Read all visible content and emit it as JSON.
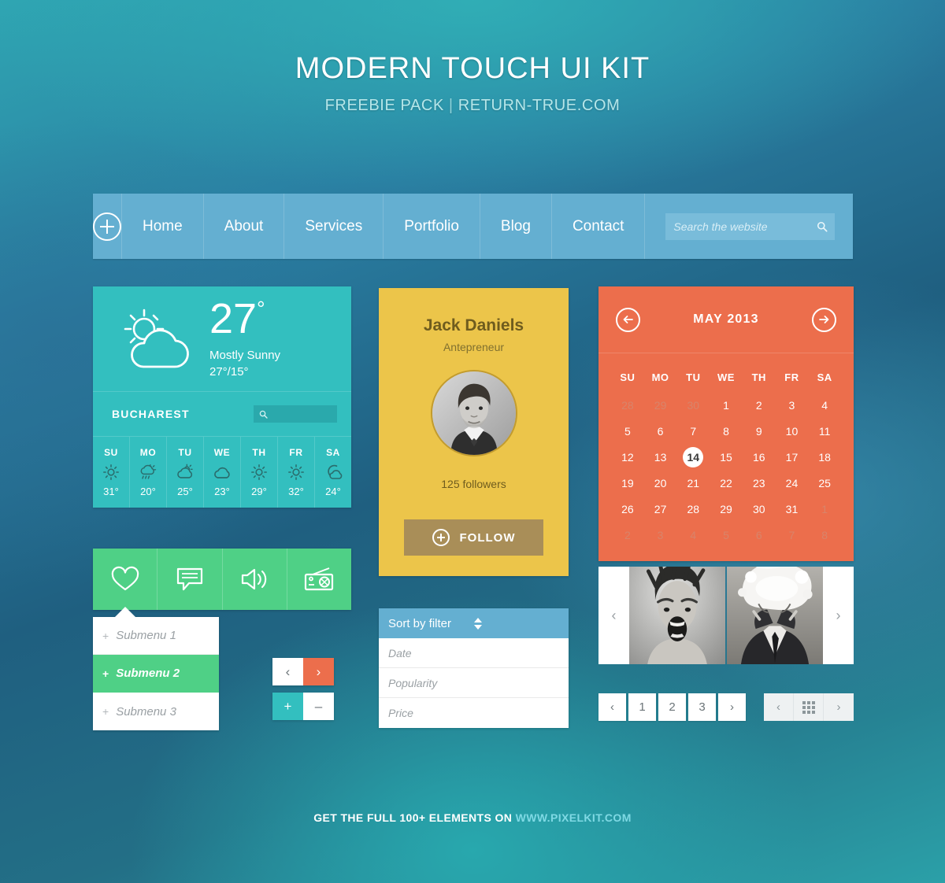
{
  "header": {
    "title": "MODERN TOUCH UI KIT",
    "subtitle_left": "FREEBIE PACK",
    "separator": "|",
    "subtitle_right": "RETURN-TRUE.COM"
  },
  "nav": {
    "plus_icon": "plus-circle-icon",
    "items": [
      {
        "label": "Home"
      },
      {
        "label": "About"
      },
      {
        "label": "Services"
      },
      {
        "label": "Portfolio"
      },
      {
        "label": "Blog"
      },
      {
        "label": "Contact"
      }
    ],
    "search": {
      "placeholder": "Search the website",
      "value": "",
      "icon": "search-icon"
    }
  },
  "weather": {
    "icon": "sun-behind-cloud-icon",
    "temperature": "27",
    "degree": "°",
    "condition": "Mostly Sunny",
    "high_low": "27°/15°",
    "city": "BUCHAREST",
    "search": {
      "placeholder": "",
      "value": "",
      "icon": "search-icon"
    },
    "forecast": [
      {
        "day": "SU",
        "icon": "sun-icon",
        "temp": "31°"
      },
      {
        "day": "MO",
        "icon": "rain-cloud-sun-icon",
        "temp": "20°"
      },
      {
        "day": "TU",
        "icon": "sun-behind-cloud-icon",
        "temp": "25°"
      },
      {
        "day": "WE",
        "icon": "cloud-icon",
        "temp": "23°"
      },
      {
        "day": "TH",
        "icon": "sun-icon",
        "temp": "29°"
      },
      {
        "day": "FR",
        "icon": "sun-icon",
        "temp": "32°"
      },
      {
        "day": "SA",
        "icon": "moon-cloud-icon",
        "temp": "24°"
      }
    ]
  },
  "iconbar": {
    "items": [
      {
        "icon": "heart-icon",
        "name": "favorites"
      },
      {
        "icon": "chat-bubble-icon",
        "name": "messages"
      },
      {
        "icon": "speaker-icon",
        "name": "sound"
      },
      {
        "icon": "radio-icon",
        "name": "radio"
      }
    ]
  },
  "submenu": {
    "items": [
      {
        "plus": "+",
        "label": "Submenu 1",
        "active": false
      },
      {
        "plus": "+",
        "label": "Submenu 2",
        "active": true
      },
      {
        "plus": "+",
        "label": "Submenu 3",
        "active": false
      }
    ]
  },
  "arrow_buttons": {
    "prev": "‹",
    "next": "›"
  },
  "plusminus_buttons": {
    "plus": "+",
    "minus": "–"
  },
  "profile": {
    "name": "Jack Daniels",
    "role": "Antepreneur",
    "avatar": "user-portrait-avatar",
    "followers": "125 followers",
    "follow_button": {
      "label": "FOLLOW",
      "icon": "plus-circle-icon"
    }
  },
  "filter": {
    "selected": "Sort by filter",
    "stepper_icon": "stepper-updown-icon",
    "options": [
      {
        "label": "Date"
      },
      {
        "label": "Popularity"
      },
      {
        "label": "Price"
      }
    ]
  },
  "calendar": {
    "title": "MAY 2013",
    "prev_icon": "arrow-left-circle-icon",
    "next_icon": "arrow-right-circle-icon",
    "weekdays": [
      "SU",
      "MO",
      "TU",
      "WE",
      "TH",
      "FR",
      "SA"
    ],
    "weeks": [
      [
        {
          "d": "28",
          "muted": true
        },
        {
          "d": "29",
          "muted": true
        },
        {
          "d": "30",
          "muted": true
        },
        {
          "d": "1"
        },
        {
          "d": "2"
        },
        {
          "d": "3"
        },
        {
          "d": "4"
        }
      ],
      [
        {
          "d": "5"
        },
        {
          "d": "6"
        },
        {
          "d": "7"
        },
        {
          "d": "8"
        },
        {
          "d": "9"
        },
        {
          "d": "10"
        },
        {
          "d": "11"
        }
      ],
      [
        {
          "d": "12"
        },
        {
          "d": "13"
        },
        {
          "d": "14",
          "today": true
        },
        {
          "d": "15"
        },
        {
          "d": "16"
        },
        {
          "d": "17"
        },
        {
          "d": "18"
        }
      ],
      [
        {
          "d": "19"
        },
        {
          "d": "20"
        },
        {
          "d": "21"
        },
        {
          "d": "22"
        },
        {
          "d": "23"
        },
        {
          "d": "24"
        },
        {
          "d": "25"
        }
      ],
      [
        {
          "d": "26"
        },
        {
          "d": "27"
        },
        {
          "d": "28"
        },
        {
          "d": "29"
        },
        {
          "d": "30"
        },
        {
          "d": "31"
        },
        {
          "d": "1",
          "muted": true
        }
      ],
      [
        {
          "d": "2",
          "muted": true
        },
        {
          "d": "3",
          "muted": true
        },
        {
          "d": "4",
          "muted": true
        },
        {
          "d": "5",
          "muted": true
        },
        {
          "d": "6",
          "muted": true
        },
        {
          "d": "7",
          "muted": true
        },
        {
          "d": "8",
          "muted": true
        }
      ]
    ]
  },
  "carousel": {
    "prev": "‹",
    "next": "›",
    "slides": [
      {
        "alt": "screaming-man-photo"
      },
      {
        "alt": "exploding-head-suit-photo"
      }
    ]
  },
  "pagination": {
    "prev": "‹",
    "next": "›",
    "pages": [
      "1",
      "2",
      "3"
    ]
  },
  "pagination_grid": {
    "prev": "‹",
    "grid_icon": "grid-view-icon",
    "next": "›"
  },
  "footer": {
    "text": "GET THE FULL 100+ ELEMENTS ON",
    "link": "WWW.PIXELKIT.COM"
  },
  "colors": {
    "nav_blue": "#64afd1",
    "weather_teal": "#33bfbf",
    "calendar_orange": "#ec6e4c",
    "profile_yellow": "#ecc54a",
    "green": "#4fd086",
    "follow_brown": "#a98e58",
    "footer_link": "#7fd9e4"
  }
}
